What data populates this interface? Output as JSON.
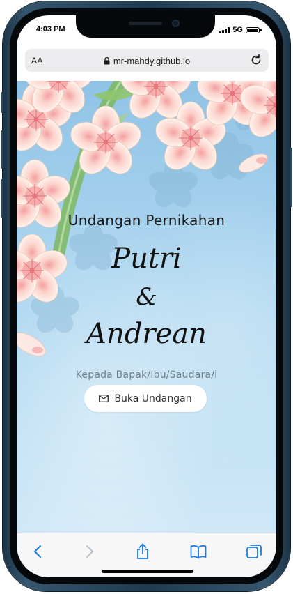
{
  "status": {
    "time": "4:03 PM",
    "network": "5G"
  },
  "browser": {
    "text_size_label": "AA",
    "domain": "mr-mahdy.github.io"
  },
  "invitation": {
    "title": "Undangan Pernikahan",
    "bride": "Putri",
    "ampersand": "&",
    "groom": "Andrean",
    "recipient_label": "Kepada Bapak/Ibu/Saudara/i",
    "open_button_label": "Buka Undangan"
  },
  "toolbar": {
    "items": [
      {
        "icon": "back-icon",
        "enabled": true
      },
      {
        "icon": "forward-icon",
        "enabled": false
      },
      {
        "icon": "share-icon",
        "enabled": true
      },
      {
        "icon": "bookmarks-icon",
        "enabled": true
      },
      {
        "icon": "tabs-icon",
        "enabled": true
      }
    ]
  },
  "colors": {
    "accent": "#1a7be0",
    "disabled": "#b9c3cc",
    "sky": "#a8d3ee",
    "petal": "#fde9e4",
    "petal_center": "#ef8e8e",
    "leaf": "#8fc56f"
  }
}
